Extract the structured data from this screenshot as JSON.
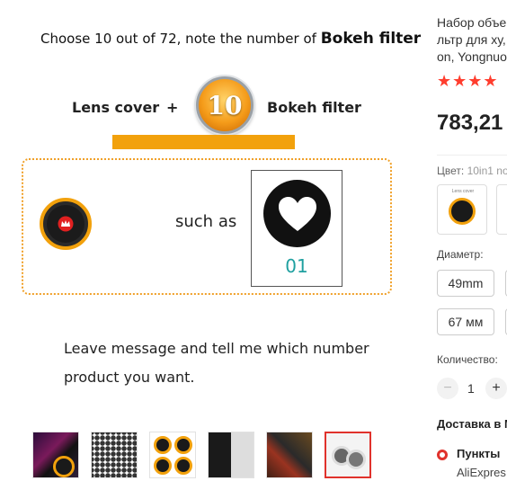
{
  "promo": {
    "title_prefix": "Choose 10 out of 72, note the number of",
    "title_strong": "Bokeh filter",
    "lens_cover_label": "Lens cover",
    "plus": "+",
    "badge_number": "10",
    "bokeh_filter_label": "Bokeh filter",
    "such_as": "such as",
    "filter_number": "01",
    "message_line1": "Leave message and tell me which number",
    "message_line2": "product you want."
  },
  "thumbnails": [
    {
      "name": "thumb-1",
      "active": false
    },
    {
      "name": "thumb-2",
      "active": false
    },
    {
      "name": "thumb-3",
      "active": false
    },
    {
      "name": "thumb-4",
      "active": false
    },
    {
      "name": "thumb-5",
      "active": false
    },
    {
      "name": "thumb-6",
      "active": true
    }
  ],
  "product": {
    "title_line1": "Набор объе",
    "title_line2": "льтр для ху,",
    "title_line3": "on, Yongnuo",
    "stars": "★★★★",
    "price": "783,21"
  },
  "options": {
    "color_label": "Цвет:",
    "color_value": "10in1 no",
    "color_thumb_caption": "Lens cover",
    "diameter_label": "Диаметр:",
    "sizes": [
      "49mm",
      "67 мм"
    ],
    "quantity_label": "Количество:",
    "quantity_minus": "−",
    "quantity_value": "1",
    "quantity_plus": "+"
  },
  "shipping": {
    "title": "Доставка в М",
    "pickup_label": "Пункты",
    "pickup_sub": "AliExpres"
  },
  "colors": {
    "accent_red": "#e0322c",
    "star_red": "#ff3d2e",
    "orange": "#f2a10c",
    "teal": "#1fa0a0"
  }
}
